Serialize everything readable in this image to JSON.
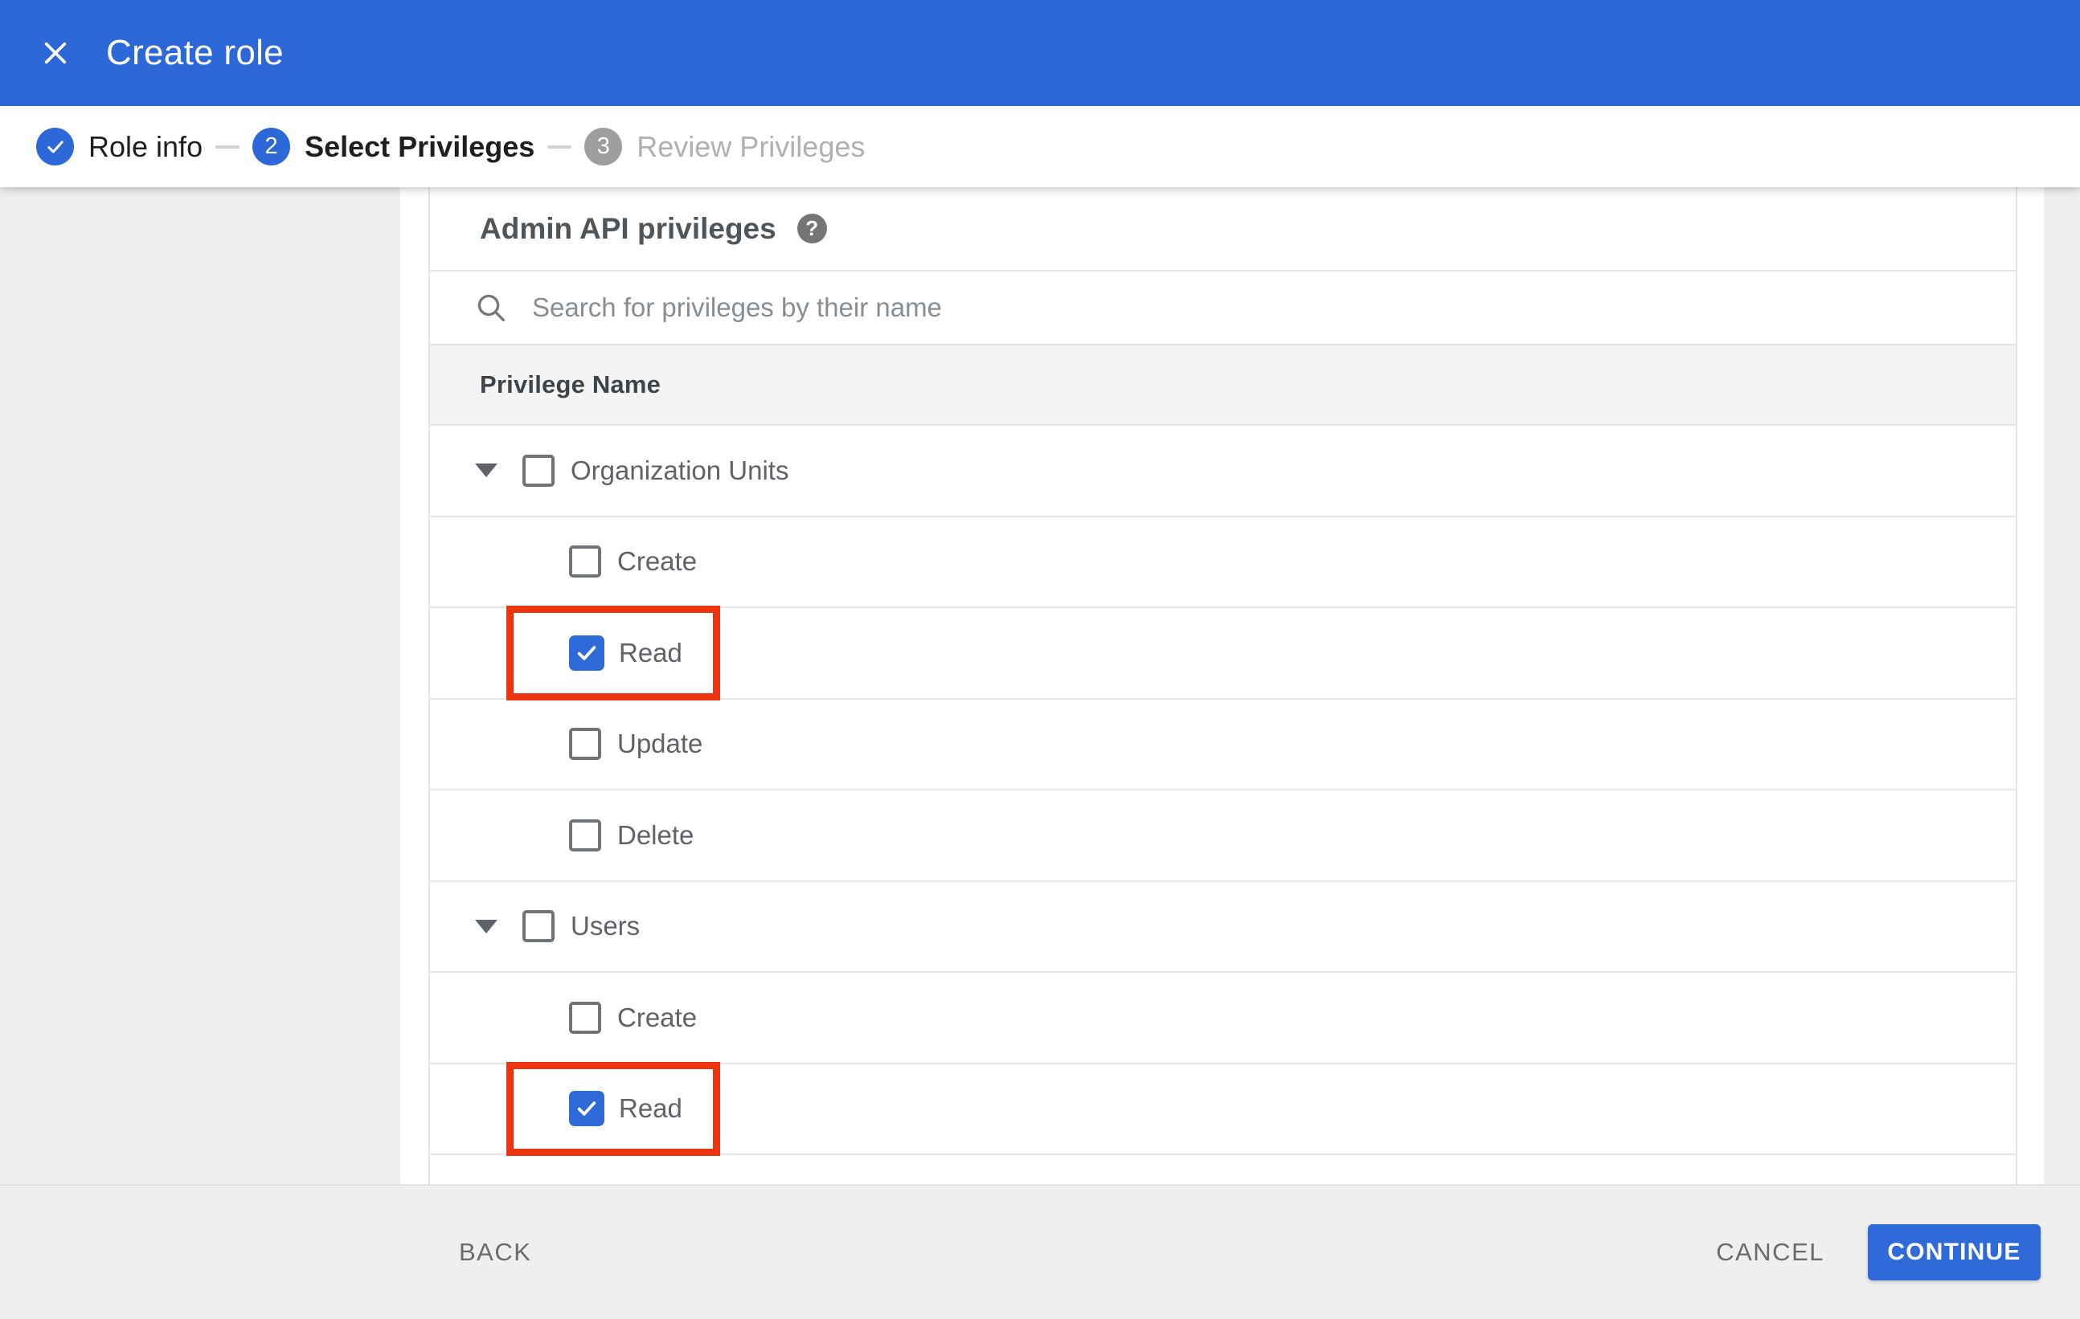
{
  "header": {
    "title": "Create role",
    "close_icon": "close-x",
    "bar_color": "#2d68d9"
  },
  "stepper": {
    "steps": [
      {
        "num": "",
        "label": "Role info",
        "state": "completed",
        "icon": "check"
      },
      {
        "num": "2",
        "label": "Select Privileges",
        "state": "active"
      },
      {
        "num": "3",
        "label": "Review Privileges",
        "state": "upcoming"
      }
    ]
  },
  "privileges": {
    "heading": "Admin API privileges",
    "help_glyph": "?",
    "search_placeholder": "Search for privileges by their name",
    "column_header": "Privilege Name",
    "rows": [
      {
        "type": "group",
        "label": "Organization Units",
        "checked": false,
        "highlighted": false,
        "expanded": true
      },
      {
        "type": "child",
        "label": "Create",
        "checked": false,
        "highlighted": false
      },
      {
        "type": "child",
        "label": "Read",
        "checked": true,
        "highlighted": true
      },
      {
        "type": "child",
        "label": "Update",
        "checked": false,
        "highlighted": false
      },
      {
        "type": "child",
        "label": "Delete",
        "checked": false,
        "highlighted": false
      },
      {
        "type": "group",
        "label": "Users",
        "checked": false,
        "highlighted": false,
        "expanded": true
      },
      {
        "type": "child",
        "label": "Create",
        "checked": false,
        "highlighted": false
      },
      {
        "type": "child",
        "label": "Read",
        "checked": true,
        "highlighted": true
      }
    ]
  },
  "footer": {
    "back_label": "BACK",
    "cancel_label": "CANCEL",
    "continue_label": "CONTINUE"
  },
  "colors": {
    "accent_blue": "#2d68d9",
    "checkbox_checked_blue": "#2e6bd8",
    "highlight_red": "#ee3512",
    "page_background": "#efefef",
    "column_header_background": "#f4f4f4",
    "inactive_step_gray": "#9e9e9e"
  }
}
